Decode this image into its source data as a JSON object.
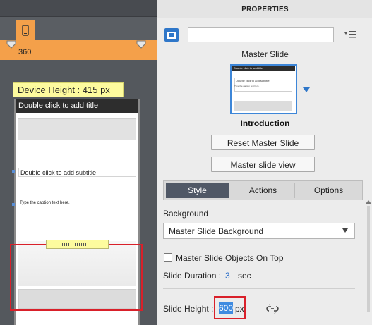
{
  "left_panel": {
    "breakpoint_value": "360",
    "device_height_label": "Device Height : 415 px",
    "stage": {
      "title_placeholder": "Double click to add title",
      "subtitle_placeholder": "Double click to add subtitle",
      "caption_placeholder": "Type the caption text here."
    }
  },
  "properties": {
    "header": "PROPERTIES",
    "name_input_value": "",
    "master_slide_label": "Master Slide",
    "thumbnail": {
      "title": "Double click to add title",
      "subtitle": "Double click to add subtitle",
      "caption": "Type the caption text here."
    },
    "selected_master": "Introduction",
    "reset_button": "Reset Master Slide",
    "view_button": "Master slide view",
    "tabs": [
      {
        "label": "Style",
        "active": true
      },
      {
        "label": "Actions",
        "active": false
      },
      {
        "label": "Options",
        "active": false
      }
    ],
    "background_label": "Background",
    "background_select_value": "Master Slide Background",
    "objects_on_top_label": "Master Slide Objects On Top",
    "objects_on_top_checked": false,
    "duration_label": "Slide Duration :",
    "duration_value": "3",
    "duration_unit": "sec",
    "height_label": "Slide Height :",
    "height_value": "600",
    "height_unit": "px"
  },
  "colors": {
    "accent_orange": "#f4a04a",
    "selection_blue": "#3f8be0",
    "highlight_red": "#d9202a",
    "tab_active": "#505866"
  }
}
